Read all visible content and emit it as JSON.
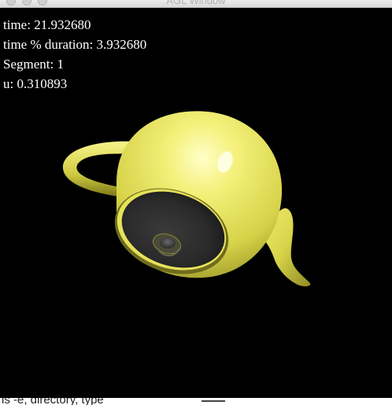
{
  "window": {
    "title": "AGL Window"
  },
  "overlay": {
    "time": "time: 21.932680",
    "time_mod_duration": "time % duration: 3.932680",
    "segment": "Segment: 1",
    "u": "u: 0.310893"
  },
  "scene": {
    "object": "teapot",
    "object_color": "#f2ee6a",
    "background_color": "#000000"
  },
  "background_terminal": {
    "partial_text": "ls -e, directory, type"
  }
}
